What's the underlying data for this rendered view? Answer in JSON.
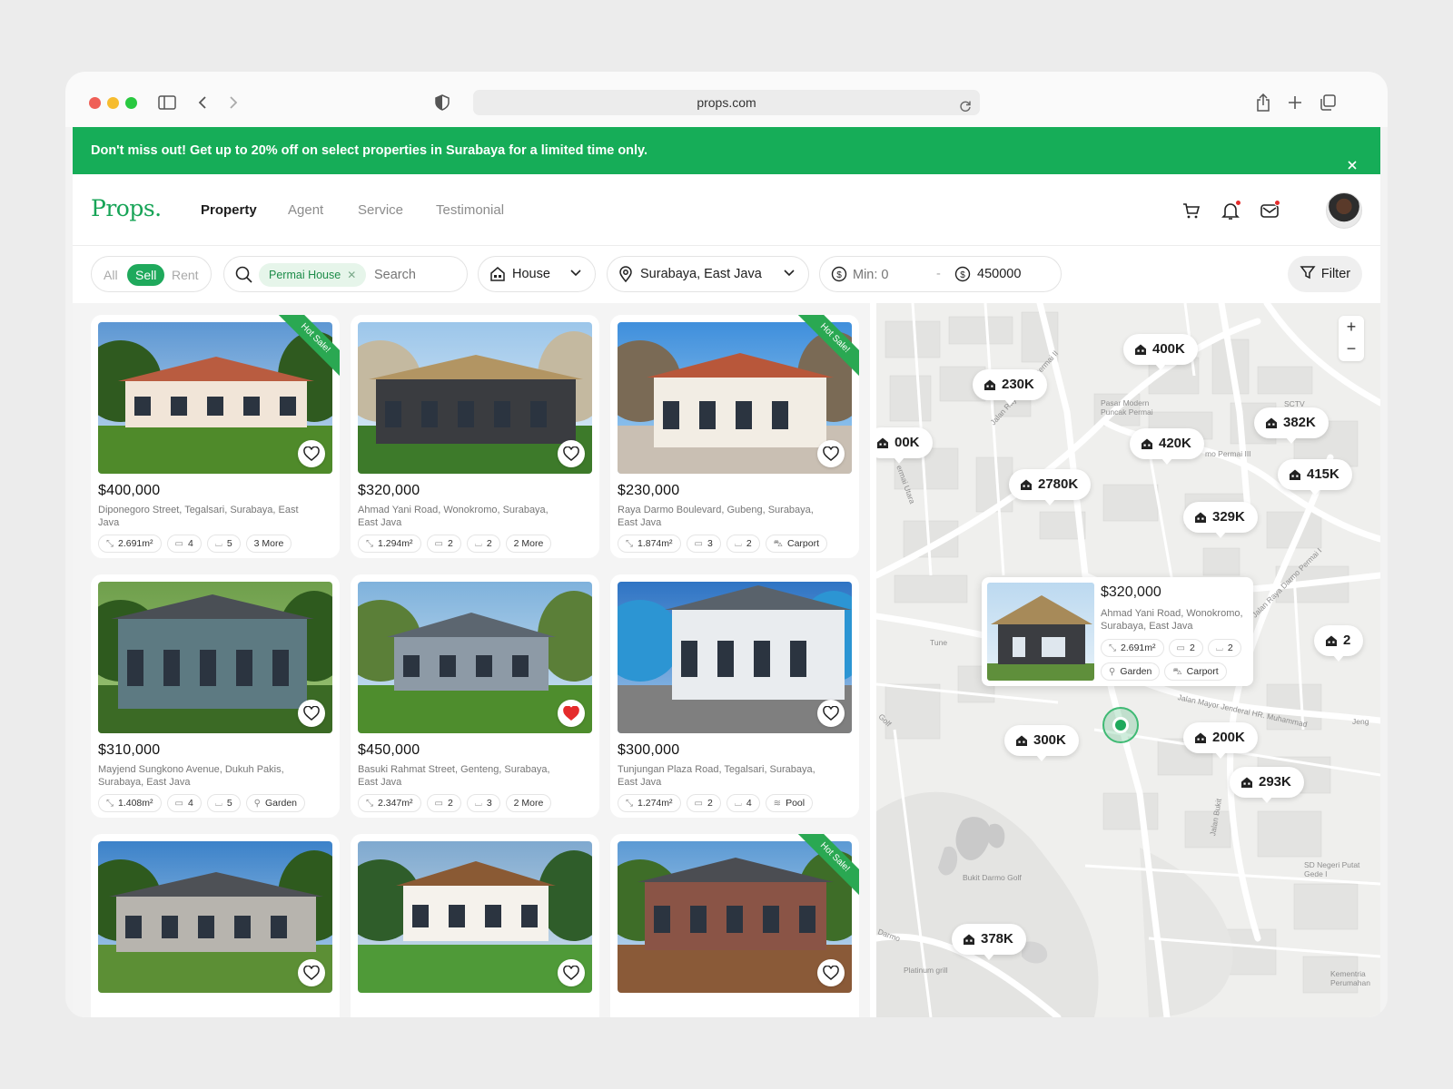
{
  "browser": {
    "url": "props.com"
  },
  "banner": {
    "text": "Don't miss out! Get up to 20% off on select properties in Surabaya for a limited time only."
  },
  "nav": {
    "logo": "Props.",
    "links": [
      "Property",
      "Agent",
      "Service",
      "Testimonial"
    ]
  },
  "filters": {
    "segments": [
      "All",
      "Sell",
      "Rent"
    ],
    "active_segment": "Sell",
    "chip": "Permai House",
    "search_placeholder": "Search",
    "type": "House",
    "location": "Surabaya, East Java",
    "min_placeholder": "Min: 0",
    "range_separator": "-",
    "max": "450000",
    "filter_label": "Filter"
  },
  "listings": [
    {
      "price": "$400,000",
      "address": "Diponegoro Street, Tegalsari, Surabaya, East Java",
      "hot": "Hot Sale!",
      "features": [
        "2.691m²",
        "4",
        "5",
        "3 More"
      ],
      "liked": false
    },
    {
      "price": "$320,000",
      "address": "Ahmad Yani Road, Wonokromo, Surabaya, East Java",
      "hot": "",
      "features": [
        "1.294m²",
        "2",
        "2",
        "2 More"
      ],
      "liked": false
    },
    {
      "price": "$230,000",
      "address": "Raya Darmo Boulevard, Gubeng, Surabaya, East Java",
      "hot": "Hot Sale!",
      "features": [
        "1.874m²",
        "3",
        "2",
        "Carport"
      ],
      "liked": false
    },
    {
      "price": "$310,000",
      "address": "Mayjend Sungkono Avenue, Dukuh Pakis, Surabaya, East Java",
      "hot": "",
      "features": [
        "1.408m²",
        "4",
        "5",
        "Garden"
      ],
      "liked": false
    },
    {
      "price": "$450,000",
      "address": "Basuki Rahmat Street, Genteng, Surabaya, East Java",
      "hot": "",
      "features": [
        "2.347m²",
        "2",
        "3",
        "2 More"
      ],
      "liked": true
    },
    {
      "price": "$300,000",
      "address": "Tunjungan Plaza Road, Tegalsari, Surabaya, East Java",
      "hot": "",
      "features": [
        "1.274m²",
        "2",
        "4",
        "Pool"
      ],
      "liked": false
    },
    {
      "price": "",
      "address": "",
      "hot": "",
      "features": [],
      "liked": false
    },
    {
      "price": "",
      "address": "",
      "hot": "",
      "features": [],
      "liked": false
    },
    {
      "price": "",
      "address": "",
      "hot": "Hot Sale!",
      "features": [],
      "liked": false
    }
  ],
  "map": {
    "zoom_in": "+",
    "zoom_out": "−",
    "markers": [
      "400K",
      "230K",
      "00K",
      "382K",
      "420K",
      "2780K",
      "415K",
      "329K",
      "2",
      "300K",
      "200K",
      "293K",
      "378K"
    ],
    "labels": [
      "Pasar Modern Puncak Permai",
      "SCTV",
      "Jalan Raya Darmo Permai II",
      "mo Permai III",
      "Jalan Raya Darmo Permai I",
      "Tune",
      "Jalan Mayor Jenderal HR. Muhammad",
      "Bukit Darmo Golf",
      "SD Negeri Putat Gede I",
      "Platinum grill",
      "Kementria Perumahan",
      "Jalan Bukit",
      "Golf",
      "Darmo",
      "Jeng",
      "ermai Utara"
    ],
    "popup": {
      "price": "$320,000",
      "address": "Ahmad Yani Road, Wonokromo, Surabaya, East Java",
      "features": [
        "2.691m²",
        "2",
        "2",
        "Garden",
        "Carport"
      ]
    }
  },
  "colors": {
    "brand": "#16ad58",
    "accent": "#1fa95c",
    "heart_liked": "#e52b2b"
  }
}
